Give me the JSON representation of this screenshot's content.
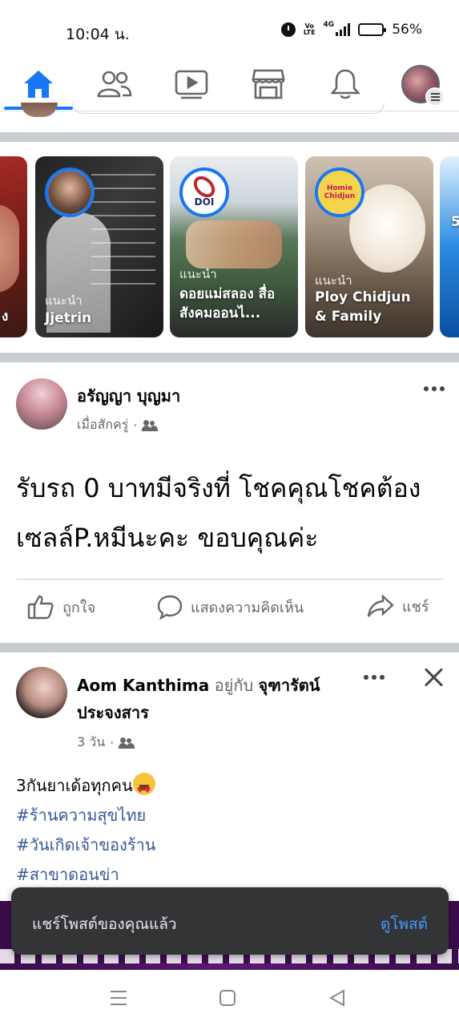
{
  "status_bar": {
    "time": "10:04 น.",
    "battery": "56%",
    "battery_level": 0.56,
    "network": "4G",
    "volte": "Vo LTE"
  },
  "nav": {
    "tabs": [
      {
        "name": "home",
        "icon": "home-icon",
        "active": true
      },
      {
        "name": "friends",
        "icon": "friends-icon",
        "active": false
      },
      {
        "name": "watch",
        "icon": "video-icon",
        "active": false
      },
      {
        "name": "marketplace",
        "icon": "store-icon",
        "active": false
      },
      {
        "name": "notifications",
        "icon": "bell-icon",
        "active": false
      },
      {
        "name": "menu",
        "icon": "profile-menu-icon",
        "active": false
      }
    ],
    "accent": "#1877f2"
  },
  "stories": [
    {
      "tag": "",
      "title": "ง"
    },
    {
      "tag": "แนะนำ",
      "title": "Jjetrin"
    },
    {
      "tag": "แนะนำ",
      "title": "ดอยแม่สลอง สื่อสังคมออนไ...",
      "badge": "DOI"
    },
    {
      "tag": "แนะนำ",
      "title": "Ploy Chidjun & Family",
      "badge": "Homie Chidjun"
    },
    {
      "tag": "",
      "title": "5"
    }
  ],
  "post1": {
    "author": "อรัญญา บุญมา",
    "time": "เมื่อสักครู่",
    "privacy_icon": "friends-icon",
    "text": "รับรถ 0 บาทมีจริงที่ โชคคุณโชคต้องเซลล์P.หมีนะคะ ขอบคุณค่ะ",
    "actions": {
      "like": "ถูกใจ",
      "comment": "แสดงความคิดเห็น",
      "share": "แชร์"
    }
  },
  "post2": {
    "author": "Aom Kanthima",
    "with_word": "อยู่กับ",
    "with_name": "จุฑารัตน์ ประจงสาร",
    "time": "3 วัน",
    "text": "3กันยาเด้อทุกคน",
    "hashtags": [
      "#ร้านความสุขไทย",
      "#วันเกิดเจ้าของร้าน",
      "#สาขาดอนข่า"
    ]
  },
  "toast": {
    "message": "แชร์โพสต์ของคุณแล้ว",
    "action": "ดูโพสต์"
  },
  "colors": {
    "accent": "#1877f2",
    "link": "#385898",
    "toast_bg": "#323436",
    "toast_action": "#4599ff"
  }
}
